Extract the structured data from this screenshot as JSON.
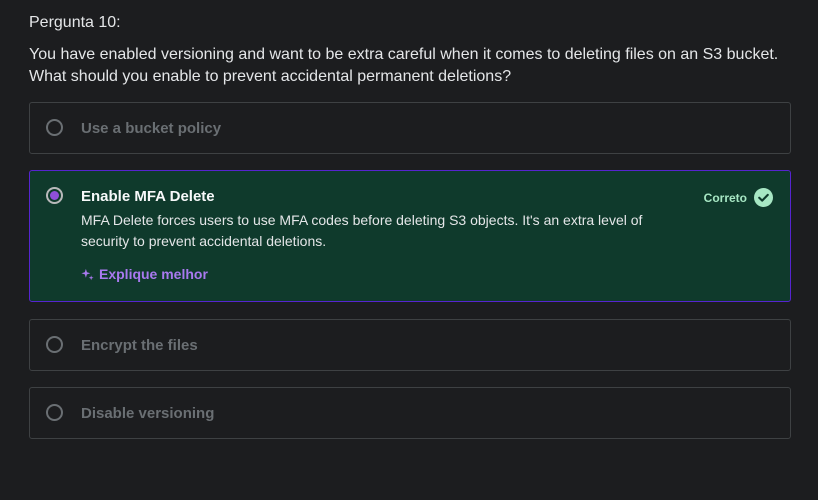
{
  "question": {
    "number_label": "Pergunta 10:",
    "text": "You have enabled versioning and want to be extra careful when it comes to deleting files on an S3 bucket. What should you enable to prevent accidental permanent deletions?"
  },
  "options": [
    {
      "label": "Use a bucket policy",
      "selected": false
    },
    {
      "label": "Enable MFA Delete",
      "selected": true,
      "status": "Correto",
      "explanation": "MFA Delete forces users to use MFA codes before deleting S3 objects. It's an extra level of security to prevent accidental deletions.",
      "explain_more_label": "Explique melhor"
    },
    {
      "label": "Encrypt the files",
      "selected": false
    },
    {
      "label": "Disable versioning",
      "selected": false
    }
  ],
  "colors": {
    "background": "#1c1d1f",
    "selected_background": "#0f3a2c",
    "selected_border": "#5624d0",
    "accent_purple": "#a879ef",
    "correct_green": "#a7e7c4"
  },
  "icons": {
    "radio": "radio-button-icon",
    "sparkle": "sparkle-icon",
    "check": "check-circle-icon"
  }
}
